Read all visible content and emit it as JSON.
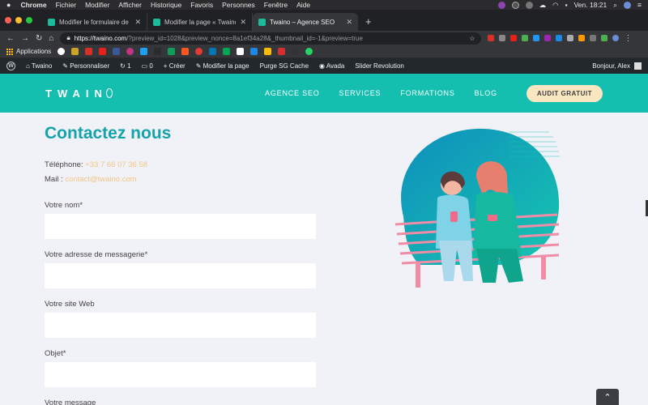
{
  "mac_menu": {
    "app": "Chrome",
    "items": [
      "Fichier",
      "Modifier",
      "Afficher",
      "Historique",
      "Favoris",
      "Personnes",
      "Fenêtre",
      "Aide"
    ],
    "clock": "Ven. 18:21"
  },
  "tabs": [
    {
      "title": "Modifier le formulaire de conta"
    },
    {
      "title": "Modifier la page « Twaino — Vi"
    },
    {
      "title": "Twaino – Agence SEO"
    }
  ],
  "address": {
    "host": "https://twaino.com",
    "path": "/?preview_id=1028&preview_nonce=8a1ef34a28&_thumbnail_id=-1&preview=true"
  },
  "bookmarks": {
    "apps_label": "Applications"
  },
  "wp_admin": {
    "site_name": "Twaino",
    "customize": "Personnaliser",
    "updates": "1",
    "comments": "0",
    "new": "Créer",
    "edit_page": "Modifier la page",
    "purge": "Purge SG Cache",
    "avada": "Avada",
    "slider": "Slider Revolution",
    "greeting": "Bonjour, Alex"
  },
  "site": {
    "logo": "TWAIN",
    "nav": [
      "AGENCE SEO",
      "SERVICES",
      "FORMATIONS",
      "BLOG"
    ],
    "cta": "AUDIT GRATUIT",
    "heading": "Contactez nous",
    "phone_label": "Téléphone:",
    "phone_value": "+33 7 66 07 36 58",
    "mail_label": "Mail :",
    "mail_value": "contact@twaino.com",
    "fields": [
      "Votre nom*",
      "Votre adresse de messagerie*",
      "Votre site Web",
      "Objet*",
      "Votre message"
    ]
  },
  "colors": {
    "brand": "#14bfb0",
    "heading": "#14a3ab",
    "cta_bg": "#fae7c1",
    "accent_text": "#f2c684"
  }
}
